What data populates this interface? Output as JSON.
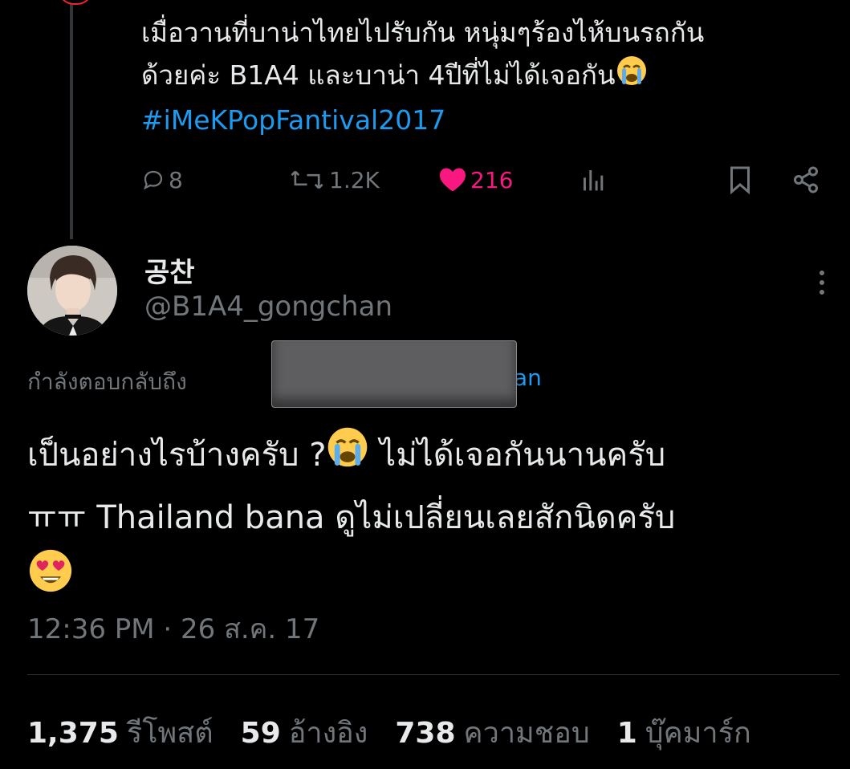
{
  "previous_tweet": {
    "line1": "เมื่อวานที่บาน่าไทยไปรับกัน หนุ่มๆร้องไห้บนรถกัน",
    "line2": "ด้วยค่ะ B1A4 และบาน่า 4ปีที่ไม่ได้เจอกัน",
    "hashtag": "#iMeKPopFantival2017",
    "actions": {
      "replies": "8",
      "retweets": "1.2K",
      "likes": "216"
    }
  },
  "tweet": {
    "display_name": "공찬",
    "handle": "@B1A4_gongchan",
    "reply_to_label": "กำลังตอบกลับถึง",
    "reply_to_visible_tail": "an",
    "text_line1": "เป็นอย่างไรบ้างครับ ?",
    "text_line1b": " ไม่ได้เจอกันนานครับ",
    "text_line2": "ㅠㅠ Thailand bana ดูไม่เปลี่ยนเลยสักนิดครับ",
    "timestamp": "12:36 PM · 26 ส.ค. 17"
  },
  "stats": [
    {
      "value": "1,375",
      "label": "รีโพสต์"
    },
    {
      "value": "59",
      "label": "อ้างอิง"
    },
    {
      "value": "738",
      "label": "ความชอบ"
    },
    {
      "value": "1",
      "label": "บุ๊คมาร์ก"
    }
  ],
  "icons": [
    "reply-icon",
    "retweet-icon",
    "heart-icon",
    "views-icon",
    "bookmark-icon",
    "share-icon",
    "more-icon",
    "crying-emoji",
    "heart-eyes-emoji"
  ],
  "colors": {
    "accent": "#1d9bf0",
    "like": "#f91880",
    "muted": "#71767b",
    "text": "#e7e9ea",
    "background": "#000000"
  }
}
